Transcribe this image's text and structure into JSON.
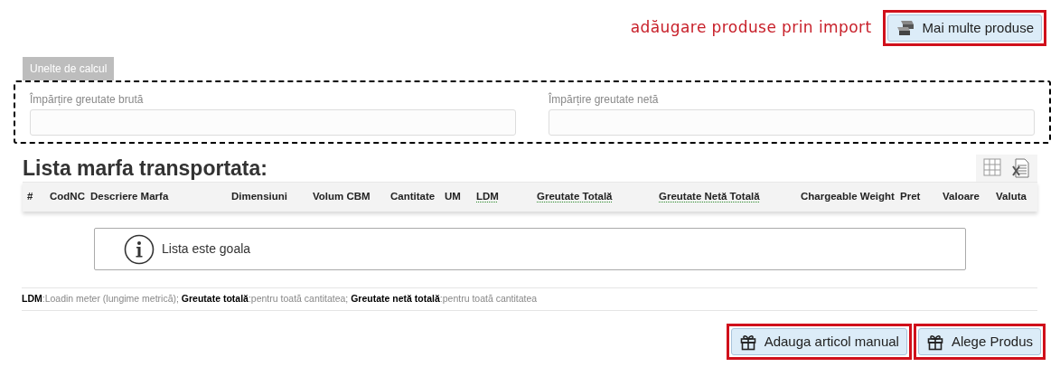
{
  "import_hint": "adăugare produse prin import",
  "more_products_button": {
    "label": "Mai multe produse",
    "highlighted": true
  },
  "calc_tools": {
    "tab": "Unelte de calcul",
    "fields": [
      {
        "label": "Împărțire greutate brută"
      },
      {
        "label": "Împărțire greutate netă"
      }
    ]
  },
  "list": {
    "title": "Lista marfa transportata:",
    "columns": [
      {
        "label": "#",
        "abbr": false
      },
      {
        "label": "CodNC",
        "abbr": false
      },
      {
        "label": "Descriere Marfa",
        "abbr": false
      },
      {
        "label": "Dimensiuni",
        "abbr": false
      },
      {
        "label": "Volum CBM",
        "abbr": false
      },
      {
        "label": "Cantitate",
        "abbr": false
      },
      {
        "label": "UM",
        "abbr": false
      },
      {
        "label": "LDM",
        "abbr": true
      },
      {
        "label": "Greutate Totală",
        "abbr": true
      },
      {
        "label": "Greutate Netă Totală",
        "abbr": true
      },
      {
        "label": "Chargeable Weight",
        "abbr": false
      },
      {
        "label": "Pret",
        "abbr": false
      },
      {
        "label": "Valoare",
        "abbr": false
      },
      {
        "label": "Valuta",
        "abbr": false
      }
    ],
    "empty_message": "Lista este goala"
  },
  "legend": "**LDM**:Loadin meter (lungime metrică); **Greutate totală**:pentru toată cantitatea; **Greutate netă totală**:pentru toată cantitatea",
  "buttons": [
    {
      "label": "Adauga articol manual",
      "highlighted": true
    },
    {
      "label": "Alege Produs",
      "highlighted": true
    }
  ]
}
